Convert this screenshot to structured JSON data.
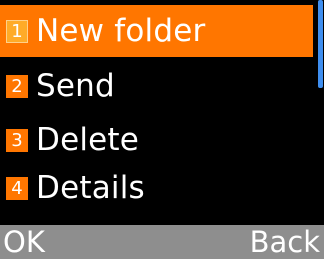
{
  "menu": {
    "items": [
      {
        "number": "1",
        "label": "New folder",
        "selected": true
      },
      {
        "number": "2",
        "label": "Send",
        "selected": false
      },
      {
        "number": "3",
        "label": "Delete",
        "selected": false
      },
      {
        "number": "4",
        "label": "Details",
        "selected": false
      }
    ]
  },
  "softkeys": {
    "left": "OK",
    "right": "Back"
  },
  "colors": {
    "accent": "#ff7600",
    "background": "#000000",
    "softkey_bar": "#8e8e8e",
    "scrollbar": "#3f8ff0"
  }
}
